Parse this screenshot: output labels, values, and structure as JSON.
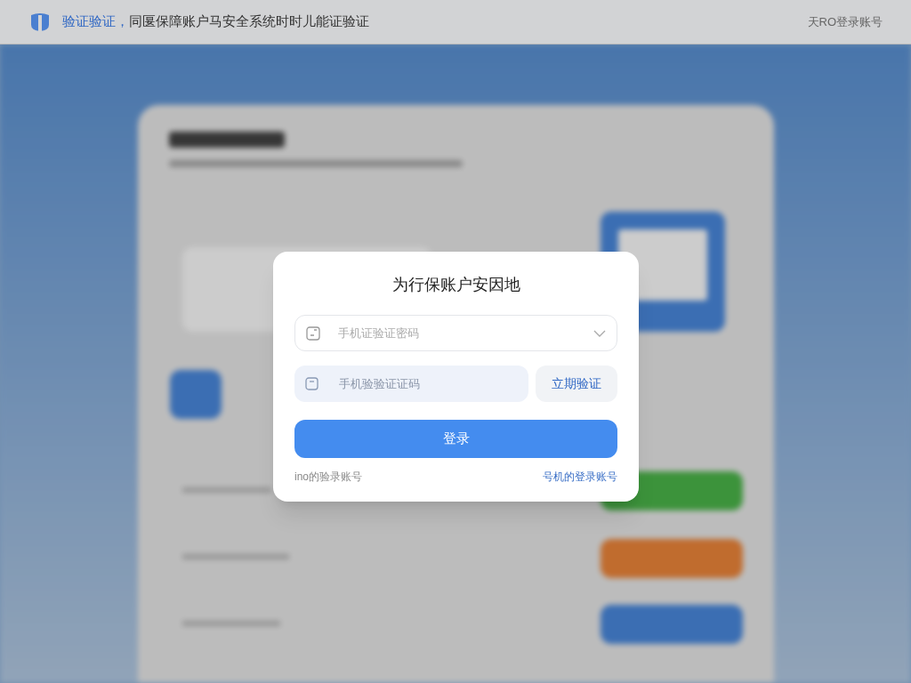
{
  "header": {
    "brand": "验证验证，",
    "tagline": "同匽保障账户马安全系统时时儿能证验证",
    "right_link": "天RO登录账号"
  },
  "dialog": {
    "title": "为行保账户安因地",
    "method_select": {
      "placeholder": "手机证验证密码"
    },
    "code_field": {
      "placeholder": "手机验验证证码"
    },
    "code_button": "立期验证",
    "submit_button": "登录",
    "footer_left": "ino的验录账号",
    "footer_right": "号机的登录账号"
  }
}
